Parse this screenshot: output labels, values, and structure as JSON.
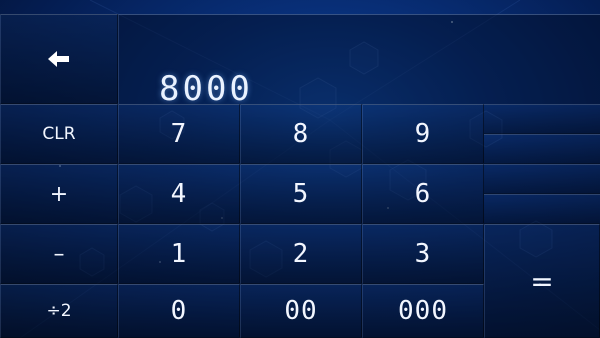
{
  "display": {
    "value": "8000"
  },
  "keys": {
    "backspace_icon": "left-arrow-icon",
    "clr": "CLR",
    "plus": "+",
    "minus": "–",
    "half": "÷2",
    "equals": "=",
    "d7": "7",
    "d8": "8",
    "d9": "9",
    "d4": "4",
    "d5": "5",
    "d6": "6",
    "d1": "1",
    "d2": "2",
    "d3": "3",
    "d0": "0",
    "d00": "00",
    "d000": "000"
  }
}
